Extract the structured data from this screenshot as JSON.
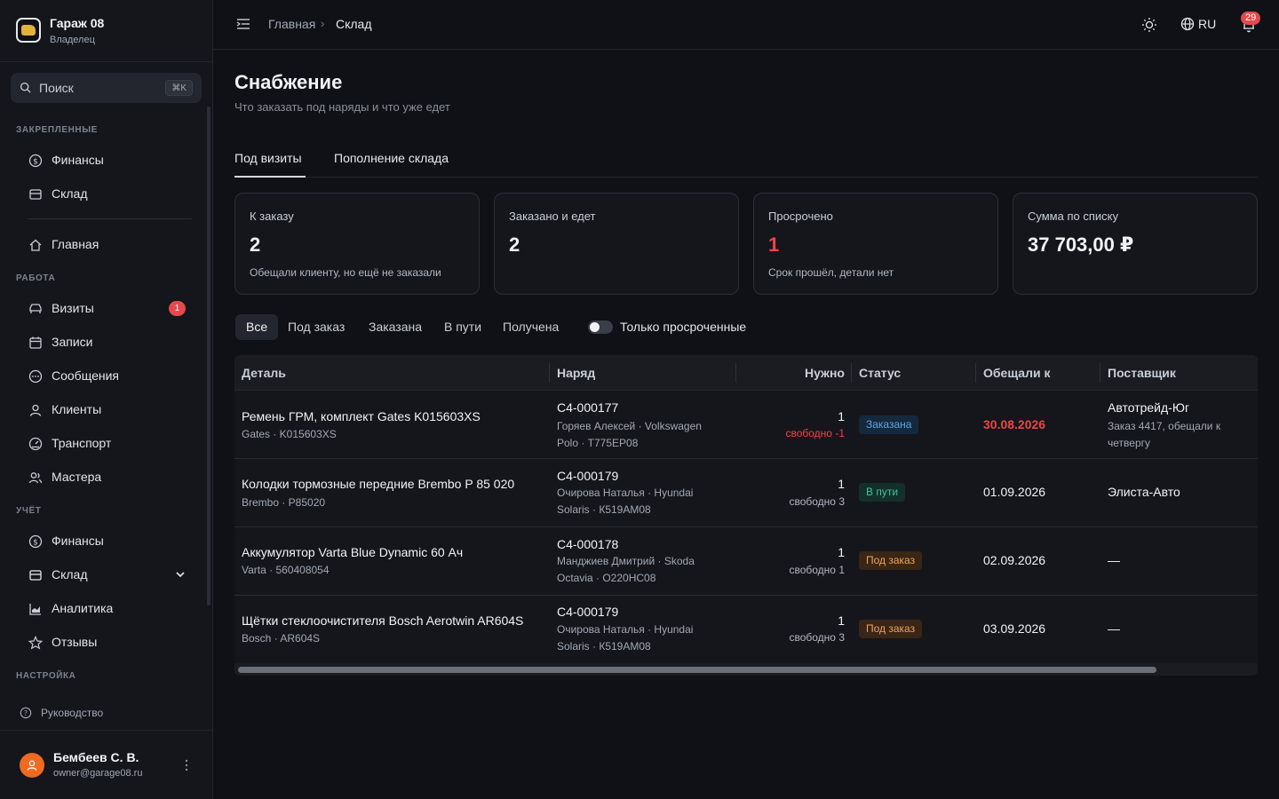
{
  "brand": {
    "name": "Гараж 08",
    "role": "Владелец"
  },
  "search": {
    "placeholder": "Поиск",
    "shortcut": "⌘K"
  },
  "sidebar": {
    "pinned_label": "ЗАКРЕПЛЕННЫЕ",
    "pinned": [
      {
        "label": "Финансы",
        "icon": "dollar-icon"
      },
      {
        "label": "Склад",
        "icon": "box-icon"
      }
    ],
    "home": {
      "label": "Главная",
      "icon": "home-icon"
    },
    "work_label": "РАБОТА",
    "work": [
      {
        "label": "Визиты",
        "icon": "car-icon",
        "badge": "1"
      },
      {
        "label": "Записи",
        "icon": "calendar-icon"
      },
      {
        "label": "Сообщения",
        "icon": "chat-icon"
      },
      {
        "label": "Клиенты",
        "icon": "user-icon"
      },
      {
        "label": "Транспорт",
        "icon": "gauge-icon"
      },
      {
        "label": "Мастера",
        "icon": "users-icon"
      }
    ],
    "accounting_label": "УЧЁТ",
    "accounting": [
      {
        "label": "Финансы",
        "icon": "dollar-icon"
      },
      {
        "label": "Склад",
        "icon": "box-icon"
      },
      {
        "label": "Аналитика",
        "icon": "chart-icon"
      },
      {
        "label": "Отзывы",
        "icon": "star-icon"
      }
    ],
    "settings_label": "НАСТРОЙКА",
    "guide": "Руководство"
  },
  "user": {
    "name": "Бембеев С. В.",
    "email": "owner@garage08.ru"
  },
  "topbar": {
    "breadcrumb_home": "Главная",
    "breadcrumb_sep": "›",
    "breadcrumb_current": "Склад",
    "lang": "RU",
    "notifications": "29"
  },
  "page": {
    "title": "Снабжение",
    "subtitle": "Что заказать под наряды и что уже едет",
    "tabs": [
      {
        "label": "Под визиты"
      },
      {
        "label": "Пополнение склада"
      }
    ]
  },
  "cards": [
    {
      "label": "К заказу",
      "value": "2",
      "sub": "Обещали клиенту, но ещё не заказали"
    },
    {
      "label": "Заказано и едет",
      "value": "2",
      "sub": ""
    },
    {
      "label": "Просрочено",
      "value": "1",
      "sub": "Срок прошёл, детали нет"
    },
    {
      "label": "Сумма по списку",
      "value": "37 703,00 ₽",
      "sub": ""
    }
  ],
  "filters": [
    {
      "label": "Все"
    },
    {
      "label": "Под заказ"
    },
    {
      "label": "Заказана"
    },
    {
      "label": "В пути"
    },
    {
      "label": "Получена"
    }
  ],
  "overdue_toggle": "Только просроченные",
  "table": {
    "columns": [
      "Деталь",
      "Наряд",
      "Нужно",
      "Статус",
      "Обещали к",
      "Поставщик"
    ],
    "rows": [
      {
        "part": "Ремень ГРМ, комплект Gates K015603XS",
        "part_sub": "Gates · K015603XS",
        "order": "С4-000177",
        "client_line1": "Горяев Алексей · Volkswagen",
        "client_line2": "Polo · Т775ЕР08",
        "need": "1",
        "free": "свободно -1",
        "status": "Заказана",
        "date": "30.08.2026",
        "supplier": "Автотрейд-Юг",
        "supplier_note": "Заказ 4417, обещали к четвергу"
      },
      {
        "part": "Колодки тормозные передние Brembo P 85 020",
        "part_sub": "Brembo · P85020",
        "order": "С4-000179",
        "client_line1": "Очирова Наталья · Hyundai",
        "client_line2": "Solaris · К519АМ08",
        "need": "1",
        "free": "свободно 3",
        "status": "В пути",
        "date": "01.09.2026",
        "supplier": "Элиста-Авто",
        "supplier_note": ""
      },
      {
        "part": "Аккумулятор Varta Blue Dynamic 60 Ач",
        "part_sub": "Varta · 560408054",
        "order": "С4-000178",
        "client_line1": "Манджиев Дмитрий · Skoda",
        "client_line2": "Octavia · О220НС08",
        "need": "1",
        "free": "свободно 1",
        "status": "Под заказ",
        "date": "02.09.2026",
        "supplier": "—",
        "supplier_note": ""
      },
      {
        "part": "Щётки стеклоочистителя Bosch Aerotwin AR604S",
        "part_sub": "Bosch · AR604S",
        "order": "С4-000179",
        "client_line1": "Очирова Наталья · Hyundai",
        "client_line2": "Solaris · К519АМ08",
        "need": "1",
        "free": "свободно 3",
        "status": "Под заказ",
        "date": "03.09.2026",
        "supplier": "—",
        "supplier_note": ""
      }
    ]
  },
  "colors": {
    "accent_red": "#ef4444",
    "status_ordered": "#5aa7e8",
    "status_transit": "#3fc39b",
    "status_to_order": "#f0a15a",
    "avatar": "#f06a20"
  }
}
